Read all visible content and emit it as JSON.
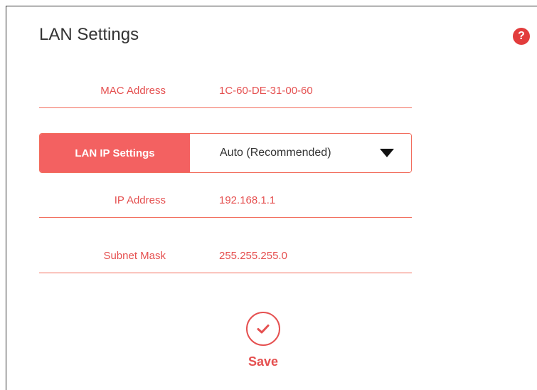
{
  "page": {
    "title": "LAN Settings",
    "help_icon": "help-icon"
  },
  "mac": {
    "label": "MAC Address",
    "value": "1C-60-DE-31-00-60"
  },
  "lan_ip_settings": {
    "label": "LAN IP Settings",
    "selected": "Auto (Recommended)"
  },
  "ip": {
    "label": "IP Address",
    "value": "192.168.1.1"
  },
  "subnet": {
    "label": "Subnet Mask",
    "value": "255.255.255.0"
  },
  "save": {
    "label": "Save",
    "icon": "check-circle-icon"
  },
  "colors": {
    "accent": "#f36161",
    "accent_text": "#e55050",
    "border": "#f26c5c",
    "title": "#333333"
  }
}
